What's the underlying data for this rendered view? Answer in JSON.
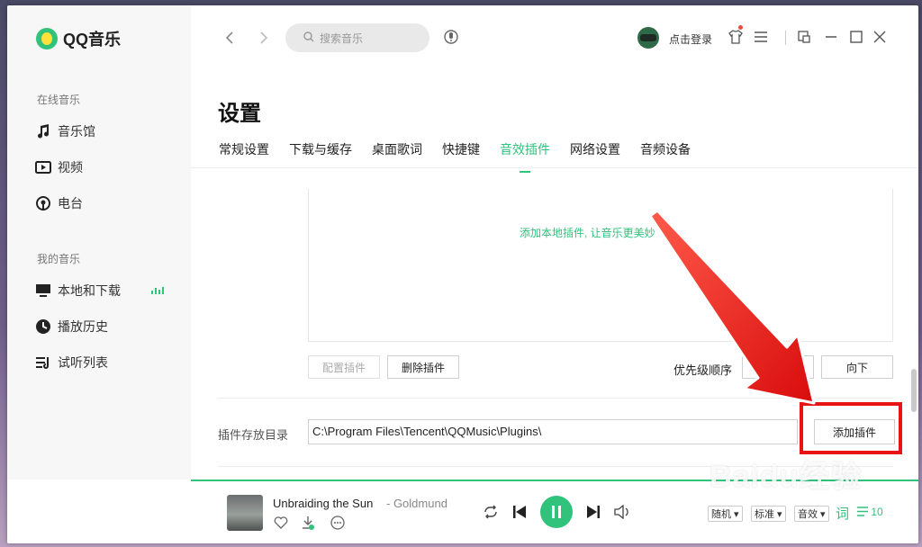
{
  "app": {
    "name": "QQ音乐"
  },
  "sidebar": {
    "group_online": "在线音乐",
    "online_items": [
      {
        "label": "音乐馆",
        "icon": "music-note-icon"
      },
      {
        "label": "视频",
        "icon": "video-icon"
      },
      {
        "label": "电台",
        "icon": "radio-icon"
      }
    ],
    "group_mine": "我的音乐",
    "mine_items": [
      {
        "label": "本地和下载",
        "icon": "monitor-icon"
      },
      {
        "label": "播放历史",
        "icon": "clock-icon"
      },
      {
        "label": "试听列表",
        "icon": "playlist-icon"
      }
    ]
  },
  "topbar": {
    "search_placeholder": "搜索音乐",
    "login": "点击登录"
  },
  "settings": {
    "title": "设置",
    "tabs": [
      "常规设置",
      "下载与缓存",
      "桌面歌词",
      "快捷键",
      "音效插件",
      "网络设置",
      "音频设备"
    ],
    "active_tab": "音效插件",
    "plugin_hint": "添加本地插件, 让音乐更美妙",
    "buttons": {
      "configure": "配置插件",
      "delete": "删除插件",
      "priority_label": "优先级顺序",
      "up": "向上",
      "down": "向下",
      "add": "添加插件"
    },
    "dir_label": "插件存放目录",
    "dir_value": "C:\\Program Files\\Tencent\\QQMusic\\Plugins\\"
  },
  "player": {
    "song": "Unbraiding the Sun",
    "artist": "- Goldmund",
    "pills": [
      "随机",
      "标准",
      "音效"
    ],
    "lyric_label": "词",
    "queue_count": "10"
  },
  "watermark": "Baidu经验",
  "colors": {
    "accent": "#31c27c",
    "highlight": "#e81414"
  }
}
